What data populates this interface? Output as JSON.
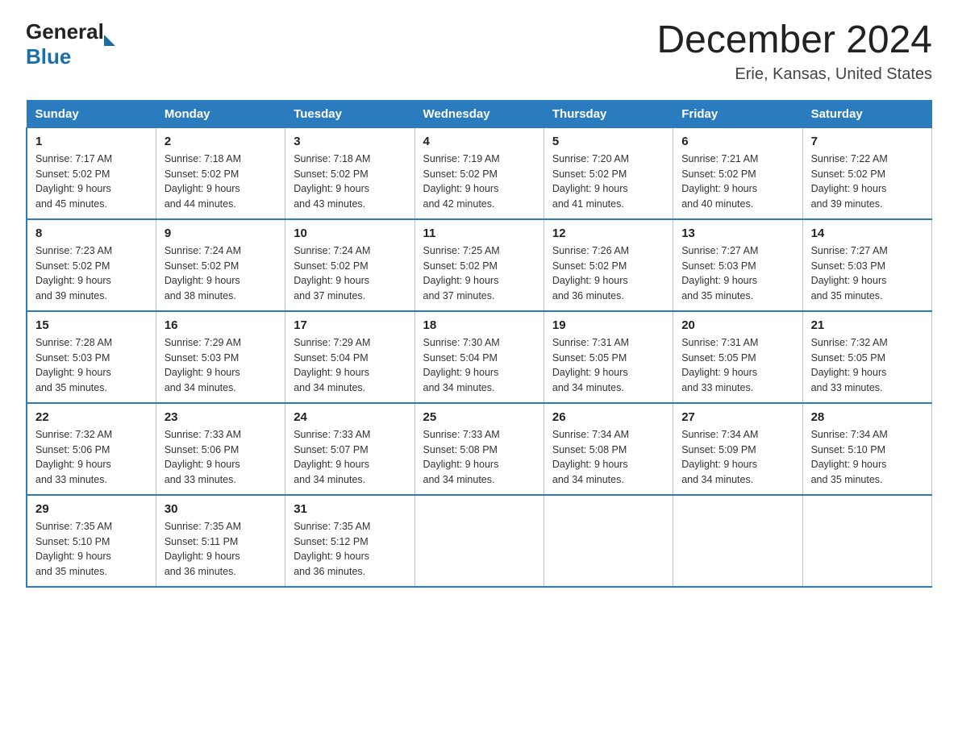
{
  "header": {
    "logo_general": "General",
    "logo_blue": "Blue",
    "month_title": "December 2024",
    "location": "Erie, Kansas, United States"
  },
  "days_of_week": [
    "Sunday",
    "Monday",
    "Tuesday",
    "Wednesday",
    "Thursday",
    "Friday",
    "Saturday"
  ],
  "weeks": [
    [
      {
        "day": "1",
        "sunrise": "7:17 AM",
        "sunset": "5:02 PM",
        "daylight": "9 hours and 45 minutes."
      },
      {
        "day": "2",
        "sunrise": "7:18 AM",
        "sunset": "5:02 PM",
        "daylight": "9 hours and 44 minutes."
      },
      {
        "day": "3",
        "sunrise": "7:18 AM",
        "sunset": "5:02 PM",
        "daylight": "9 hours and 43 minutes."
      },
      {
        "day": "4",
        "sunrise": "7:19 AM",
        "sunset": "5:02 PM",
        "daylight": "9 hours and 42 minutes."
      },
      {
        "day": "5",
        "sunrise": "7:20 AM",
        "sunset": "5:02 PM",
        "daylight": "9 hours and 41 minutes."
      },
      {
        "day": "6",
        "sunrise": "7:21 AM",
        "sunset": "5:02 PM",
        "daylight": "9 hours and 40 minutes."
      },
      {
        "day": "7",
        "sunrise": "7:22 AM",
        "sunset": "5:02 PM",
        "daylight": "9 hours and 39 minutes."
      }
    ],
    [
      {
        "day": "8",
        "sunrise": "7:23 AM",
        "sunset": "5:02 PM",
        "daylight": "9 hours and 39 minutes."
      },
      {
        "day": "9",
        "sunrise": "7:24 AM",
        "sunset": "5:02 PM",
        "daylight": "9 hours and 38 minutes."
      },
      {
        "day": "10",
        "sunrise": "7:24 AM",
        "sunset": "5:02 PM",
        "daylight": "9 hours and 37 minutes."
      },
      {
        "day": "11",
        "sunrise": "7:25 AM",
        "sunset": "5:02 PM",
        "daylight": "9 hours and 37 minutes."
      },
      {
        "day": "12",
        "sunrise": "7:26 AM",
        "sunset": "5:02 PM",
        "daylight": "9 hours and 36 minutes."
      },
      {
        "day": "13",
        "sunrise": "7:27 AM",
        "sunset": "5:03 PM",
        "daylight": "9 hours and 35 minutes."
      },
      {
        "day": "14",
        "sunrise": "7:27 AM",
        "sunset": "5:03 PM",
        "daylight": "9 hours and 35 minutes."
      }
    ],
    [
      {
        "day": "15",
        "sunrise": "7:28 AM",
        "sunset": "5:03 PM",
        "daylight": "9 hours and 35 minutes."
      },
      {
        "day": "16",
        "sunrise": "7:29 AM",
        "sunset": "5:03 PM",
        "daylight": "9 hours and 34 minutes."
      },
      {
        "day": "17",
        "sunrise": "7:29 AM",
        "sunset": "5:04 PM",
        "daylight": "9 hours and 34 minutes."
      },
      {
        "day": "18",
        "sunrise": "7:30 AM",
        "sunset": "5:04 PM",
        "daylight": "9 hours and 34 minutes."
      },
      {
        "day": "19",
        "sunrise": "7:31 AM",
        "sunset": "5:05 PM",
        "daylight": "9 hours and 34 minutes."
      },
      {
        "day": "20",
        "sunrise": "7:31 AM",
        "sunset": "5:05 PM",
        "daylight": "9 hours and 33 minutes."
      },
      {
        "day": "21",
        "sunrise": "7:32 AM",
        "sunset": "5:05 PM",
        "daylight": "9 hours and 33 minutes."
      }
    ],
    [
      {
        "day": "22",
        "sunrise": "7:32 AM",
        "sunset": "5:06 PM",
        "daylight": "9 hours and 33 minutes."
      },
      {
        "day": "23",
        "sunrise": "7:33 AM",
        "sunset": "5:06 PM",
        "daylight": "9 hours and 33 minutes."
      },
      {
        "day": "24",
        "sunrise": "7:33 AM",
        "sunset": "5:07 PM",
        "daylight": "9 hours and 34 minutes."
      },
      {
        "day": "25",
        "sunrise": "7:33 AM",
        "sunset": "5:08 PM",
        "daylight": "9 hours and 34 minutes."
      },
      {
        "day": "26",
        "sunrise": "7:34 AM",
        "sunset": "5:08 PM",
        "daylight": "9 hours and 34 minutes."
      },
      {
        "day": "27",
        "sunrise": "7:34 AM",
        "sunset": "5:09 PM",
        "daylight": "9 hours and 34 minutes."
      },
      {
        "day": "28",
        "sunrise": "7:34 AM",
        "sunset": "5:10 PM",
        "daylight": "9 hours and 35 minutes."
      }
    ],
    [
      {
        "day": "29",
        "sunrise": "7:35 AM",
        "sunset": "5:10 PM",
        "daylight": "9 hours and 35 minutes."
      },
      {
        "day": "30",
        "sunrise": "7:35 AM",
        "sunset": "5:11 PM",
        "daylight": "9 hours and 36 minutes."
      },
      {
        "day": "31",
        "sunrise": "7:35 AM",
        "sunset": "5:12 PM",
        "daylight": "9 hours and 36 minutes."
      },
      null,
      null,
      null,
      null
    ]
  ],
  "labels": {
    "sunrise": "Sunrise:",
    "sunset": "Sunset:",
    "daylight": "Daylight:"
  }
}
